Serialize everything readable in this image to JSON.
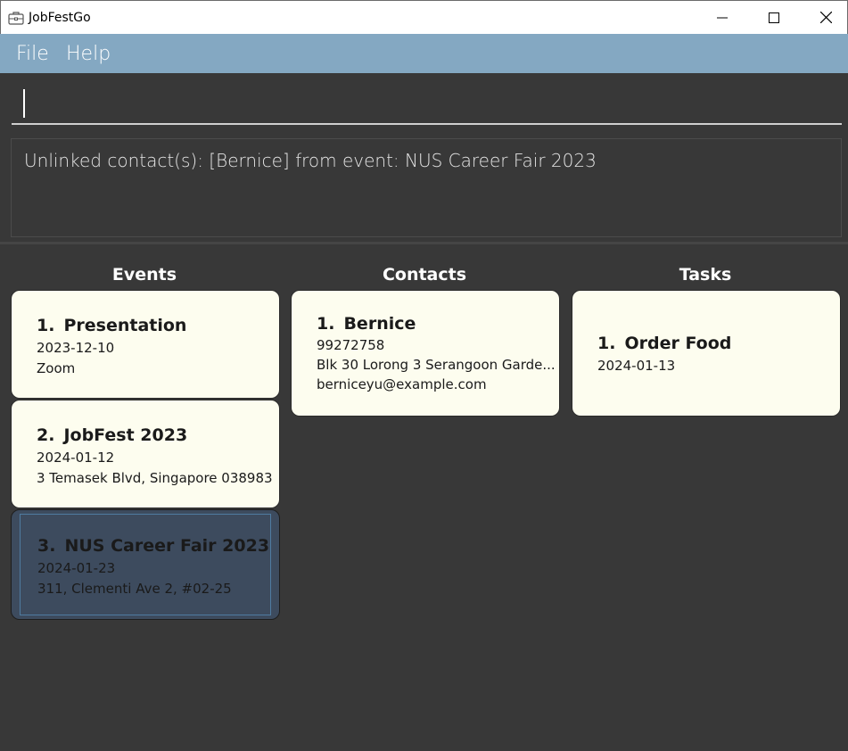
{
  "window": {
    "title": "JobFestGo",
    "controls": {
      "minimize_icon": "minimize-icon",
      "maximize_icon": "maximize-icon",
      "close_icon": "close-icon"
    }
  },
  "menu": {
    "file_label": "File",
    "help_label": "Help"
  },
  "command": {
    "value": "",
    "placeholder": ""
  },
  "result": {
    "message": "Unlinked contact(s): [Bernice] from event: NUS Career Fair 2023"
  },
  "panels": {
    "events_title": "Events",
    "contacts_title": "Contacts",
    "tasks_title": "Tasks"
  },
  "events": [
    {
      "index": "1.",
      "name": "Presentation",
      "date": "2023-12-10",
      "venue": "Zoom"
    },
    {
      "index": "2.",
      "name": "JobFest 2023",
      "date": "2024-01-12",
      "venue": "3 Temasek Blvd, Singapore 038983"
    },
    {
      "index": "3.",
      "name": "NUS Career Fair 2023",
      "date": "2024-01-23",
      "venue": "311, Clementi Ave 2, #02-25",
      "selected": true
    }
  ],
  "contacts": [
    {
      "index": "1.",
      "name": "Bernice",
      "phone": "99272758",
      "address": "Blk 30 Lorong 3 Serangoon Garde...",
      "email": "berniceyu@example.com"
    }
  ],
  "tasks": [
    {
      "index": "1.",
      "description": "Order Food",
      "deadline": "2024-01-13"
    }
  ],
  "colors": {
    "menu_bar": "#84a8c2",
    "background": "#383838",
    "card": "#fdfdef",
    "selected_card": "#3d4b5e"
  }
}
